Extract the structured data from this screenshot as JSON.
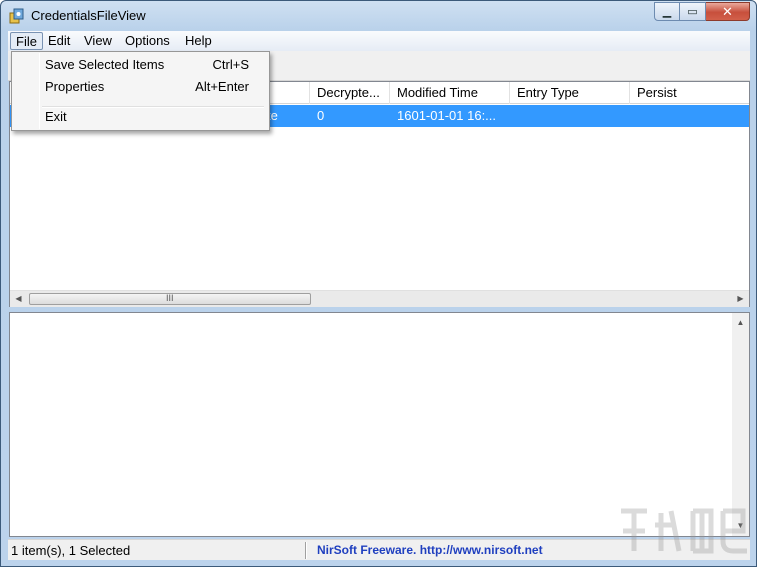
{
  "window": {
    "title": "CredentialsFileView",
    "minimize_icon": "minimize-icon",
    "maximize_icon": "maximize-icon",
    "close_icon": "close-icon"
  },
  "menubar": {
    "items": [
      {
        "label": "File"
      },
      {
        "label": "Edit"
      },
      {
        "label": "View"
      },
      {
        "label": "Options"
      },
      {
        "label": "Help"
      }
    ]
  },
  "file_menu": {
    "items": [
      {
        "label": "Save Selected Items",
        "shortcut": "Ctrl+S"
      },
      {
        "label": "Properties",
        "shortcut": "Alt+Enter"
      },
      {
        "label": "Exit",
        "shortcut": ""
      }
    ]
  },
  "list": {
    "columns": [
      "Decrypte...",
      "Modified Time",
      "Entry Type",
      "Persist"
    ],
    "rows": [
      {
        "partial_name": "te",
        "decrypted": "0",
        "modified_time": "1601-01-01 16:...",
        "entry_type": "",
        "persist": ""
      }
    ],
    "selection_color": "#3399ff",
    "hscroll_grip": "III"
  },
  "statusbar": {
    "left_text": "1 item(s), 1 Selected",
    "right_text": "NirSoft Freeware.  http://www.nirsoft.net",
    "link_color": "#1f3fbf"
  }
}
